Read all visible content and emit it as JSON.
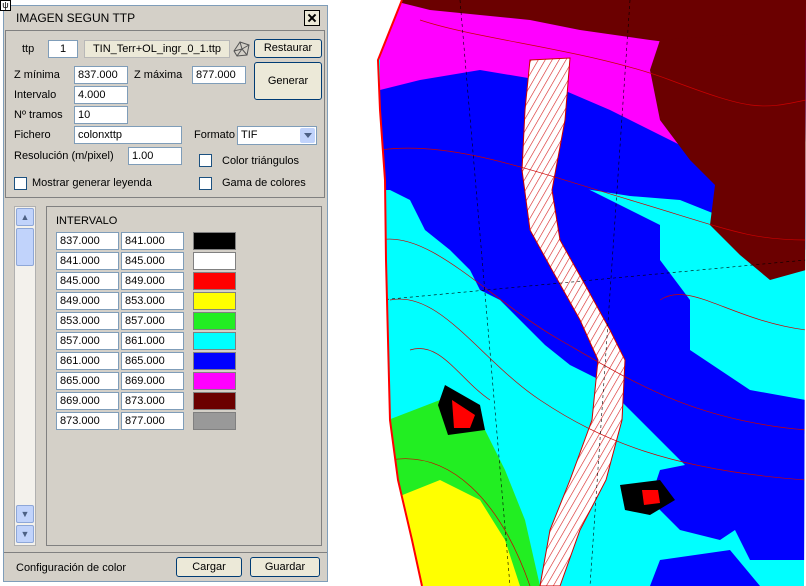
{
  "window": {
    "title": "IMAGEN SEGUN TTP",
    "pin_label": "ψ"
  },
  "form": {
    "ttp_label": "ttp",
    "ttp_number": "1",
    "ttp_file": "TIN_Terr+OL_ingr_0_1.ttp",
    "restore_label": "Restaurar",
    "generate_label": "Generar",
    "zmin_label": "Z mínima",
    "zmin_value": "837.000",
    "zmax_label": "Z máxima",
    "zmax_value": "877.000",
    "interval_label": "Intervalo",
    "interval_value": "4.000",
    "tramos_label": "Nº tramos",
    "tramos_value": "10",
    "file_label": "Fichero",
    "file_value": "colonxttp",
    "format_label": "Formato",
    "format_value": "TIF",
    "resolution_label": "Resolución (m/pixel)",
    "resolution_value": "1.00",
    "color_triangles_label": "Color triángulos",
    "color_triangles_checked": false,
    "show_legend_label": "Mostrar generar leyenda",
    "show_legend_checked": false,
    "color_range_label": "Gama de colores",
    "color_range_checked": false
  },
  "intervals": {
    "header": "INTERVALO",
    "rows": [
      {
        "from": "837.000",
        "to": "841.000",
        "color": "#000000"
      },
      {
        "from": "841.000",
        "to": "845.000",
        "color": "#ffffff"
      },
      {
        "from": "845.000",
        "to": "849.000",
        "color": "#ff0000"
      },
      {
        "from": "849.000",
        "to": "853.000",
        "color": "#ffff00"
      },
      {
        "from": "853.000",
        "to": "857.000",
        "color": "#22ee22"
      },
      {
        "from": "857.000",
        "to": "861.000",
        "color": "#00ffff"
      },
      {
        "from": "861.000",
        "to": "865.000",
        "color": "#0000ff"
      },
      {
        "from": "865.000",
        "to": "869.000",
        "color": "#ff00ff"
      },
      {
        "from": "869.000",
        "to": "873.000",
        "color": "#6b0000"
      },
      {
        "from": "873.000",
        "to": "877.000",
        "color": "#999999"
      }
    ]
  },
  "footer": {
    "label": "Configuración de color",
    "load_label": "Cargar",
    "save_label": "Guardar"
  },
  "map": {
    "name": "elevation-raster"
  }
}
